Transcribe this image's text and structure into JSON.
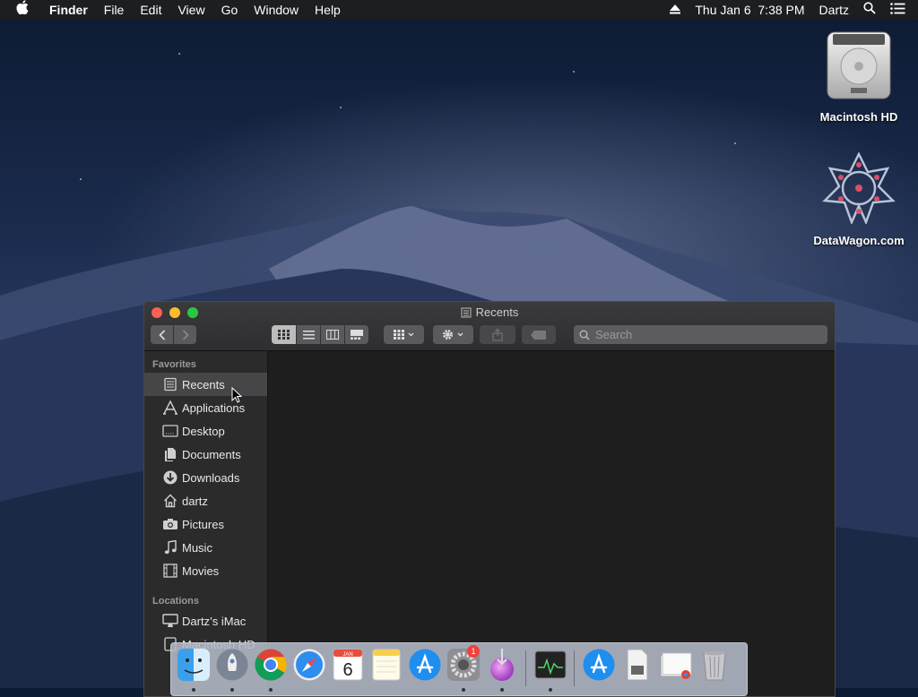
{
  "menubar": {
    "app_name": "Finder",
    "menus": [
      "File",
      "Edit",
      "View",
      "Go",
      "Window",
      "Help"
    ],
    "clock": "Thu Jan 6  7:38 PM",
    "user": "Dartz"
  },
  "desktop": {
    "icons": [
      {
        "label": "Macintosh HD",
        "icon": "hard-drive-icon"
      },
      {
        "label": "DataWagon.com",
        "icon": "network-volume-icon"
      }
    ]
  },
  "finder": {
    "title": "Recents",
    "search_placeholder": "Search",
    "sidebar": {
      "favorites_heading": "Favorites",
      "favorites": [
        "Recents",
        "Applications",
        "Desktop",
        "Documents",
        "Downloads",
        "dartz",
        "Pictures",
        "Music",
        "Movies"
      ],
      "locations_heading": "Locations",
      "locations": [
        "Dartz’s iMac",
        "Macintosh HD"
      ]
    }
  },
  "dock": {
    "apps": [
      "Finder",
      "Launchpad",
      "Chrome",
      "Safari",
      "Calendar",
      "Notes",
      "App Store",
      "System Preferences",
      "Installer",
      "Activity Monitor",
      "App Store Downloads",
      "Documents",
      "Chrome Files",
      "Trash"
    ],
    "calendar_day": "6",
    "calendar_month": "JAN",
    "sysprefs_badge": "1"
  },
  "colors": {
    "close": "#fc5f57",
    "minimize": "#fdbc2e",
    "maximize": "#28c840",
    "sidebar_bg": "#2b2b2c",
    "content_bg": "#1e1e1e"
  }
}
